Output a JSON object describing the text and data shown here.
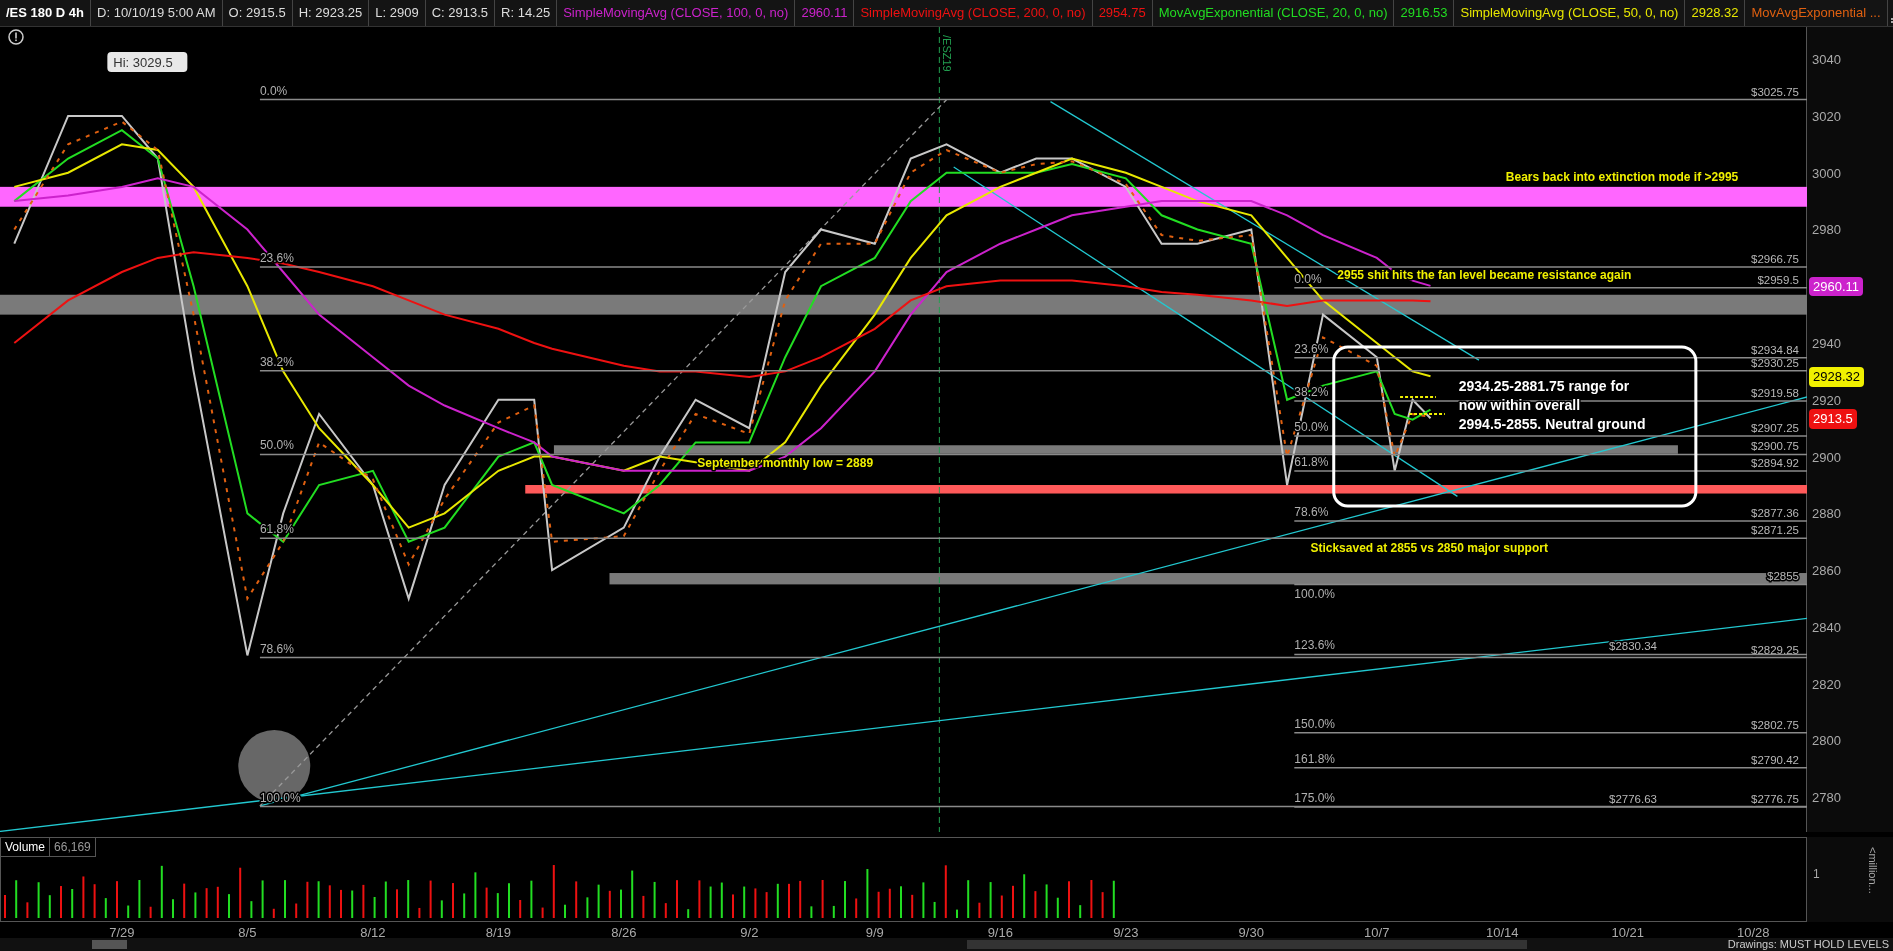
{
  "header": {
    "symbol": "/ES 180 D 4h",
    "fields": [
      "D: 10/10/19 5:00 AM",
      "O: 2915.5",
      "H: 2923.25",
      "L: 2909",
      "C: 2913.5",
      "R: 14.25"
    ],
    "studies": [
      {
        "name": "SimpleMovingAvg (CLOSE, 100, 0, no)",
        "value": "2960.11",
        "color": "#cc22cc"
      },
      {
        "name": "SimpleMovingAvg (CLOSE, 200, 0, no)",
        "value": "2954.75",
        "color": "#ee1111"
      },
      {
        "name": "MovAvgExponential (CLOSE, 20, 0, no)",
        "value": "2916.53",
        "color": "#22dd22"
      },
      {
        "name": "SimpleMovingAvg (CLOSE, 50, 0, no)",
        "value": "2928.32",
        "color": "#e8e800"
      },
      {
        "name": "MovAvgExponential ...",
        "color": "#e06010"
      }
    ]
  },
  "chart": {
    "hi_callout": "Hi: 3029.5",
    "contract_label": "/ESZ19",
    "fib_left": [
      {
        "percent": "0.0%",
        "price_label": "$3025.75"
      },
      {
        "percent": "23.6%",
        "price_label": "$2966.75"
      },
      {
        "percent": "38.2%",
        "price_label": "$2930.25"
      },
      {
        "percent": "50.0%",
        "price_label": "$2900.75"
      },
      {
        "percent": "61.8%",
        "price_label": "$2871.25"
      },
      {
        "percent": "78.6%",
        "price_label": "$2829.25"
      },
      {
        "percent": "100.0%",
        "price_label": "$2776.75"
      }
    ],
    "fib_right": [
      {
        "percent": "0.0%",
        "price_label": "$2959.5"
      },
      {
        "percent": "23.6%",
        "price_label": "$2934.84"
      },
      {
        "percent": "38.2%",
        "price_label": "$2919.58"
      },
      {
        "percent": "50.0%",
        "price_label": "$2907.25"
      },
      {
        "percent": "61.8%",
        "price_label": "$2894.92"
      },
      {
        "percent": "78.6%",
        "price_label": "$2877.36"
      },
      {
        "percent": "100.0%",
        "price_label": "$2855"
      },
      {
        "percent": "123.6%",
        "price_label": "$2830.34"
      },
      {
        "percent": "150.0%",
        "price_label": "$2802.75"
      },
      {
        "percent": "161.8%",
        "price_label": "$2790.42"
      },
      {
        "percent": "175.0%",
        "price_label": "$2776.63"
      }
    ],
    "notes": [
      "Bears back into extinction mode if >2995",
      "2955 shit hits the fan level became resistance again",
      "September monthly low = 2889",
      "Sticksaved at 2855 vs 2850 major support"
    ],
    "range_note": [
      "2934.25-2881.75 range for",
      "now within overall",
      "2994.5-2855. Neutral ground"
    ],
    "badges": [
      {
        "text": "2960.11",
        "color": "#cc22cc"
      },
      {
        "text": "2928.32",
        "color": "#f0f000"
      },
      {
        "text": "2913.5",
        "color": "#ee1111"
      }
    ],
    "price_axis": [
      "3040",
      "3020",
      "3000",
      "2980",
      "2940",
      "2920",
      "2900",
      "2880",
      "2860",
      "2840",
      "2820",
      "2800",
      "2780"
    ],
    "date_axis": [
      "7/29",
      "8/5",
      "8/12",
      "8/19",
      "8/26",
      "9/2",
      "9/9",
      "9/16",
      "9/23",
      "9/30",
      "10/7",
      "10/14",
      "10/21",
      "10/28"
    ]
  },
  "volume": {
    "label": "Volume",
    "value": "66,169",
    "tick": "1",
    "unit": "<million..."
  },
  "footer": {
    "drawings": "Drawings: MUST HOLD LEVELS"
  }
}
